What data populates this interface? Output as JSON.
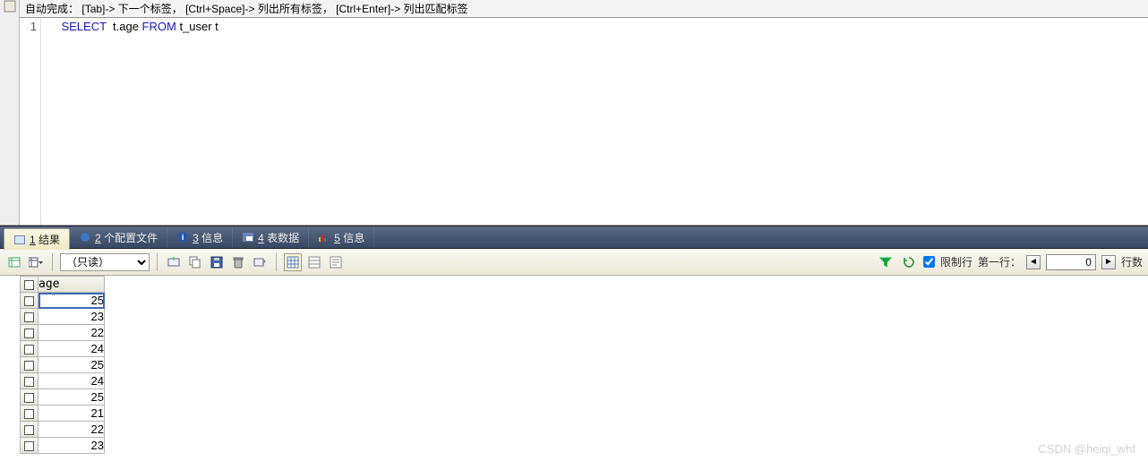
{
  "hint": {
    "prefix": "自动完成：",
    "h1_key": "[Tab]->",
    "h1_txt": "下一个标签，",
    "h2_key": "[Ctrl+Space]->",
    "h2_txt": "列出所有标签，",
    "h3_key": "[Ctrl+Enter]->",
    "h3_txt": "列出匹配标签"
  },
  "sql": {
    "line_no": "1",
    "kw1": "SELECT",
    "expr": "  t.age ",
    "kw2": "FROM",
    "tail": " t_user t"
  },
  "tabs": [
    {
      "num": "1",
      "label": "结果"
    },
    {
      "num": "2",
      "label": "个配置文件"
    },
    {
      "num": "3",
      "label": "信息"
    },
    {
      "num": "4",
      "label": "表数据"
    },
    {
      "num": "5",
      "label": "信息"
    }
  ],
  "toolbar": {
    "mode_label": "（只读）",
    "filter_checked": true,
    "limit_label": "限制行",
    "firstrow_label": "第一行：",
    "firstrow_value": "0",
    "rowcount_label": "行数"
  },
  "grid": {
    "column": "age",
    "rows": [
      "25",
      "23",
      "22",
      "24",
      "25",
      "24",
      "25",
      "21",
      "22",
      "23"
    ]
  },
  "watermark": "CSDN @heiqi_whf"
}
